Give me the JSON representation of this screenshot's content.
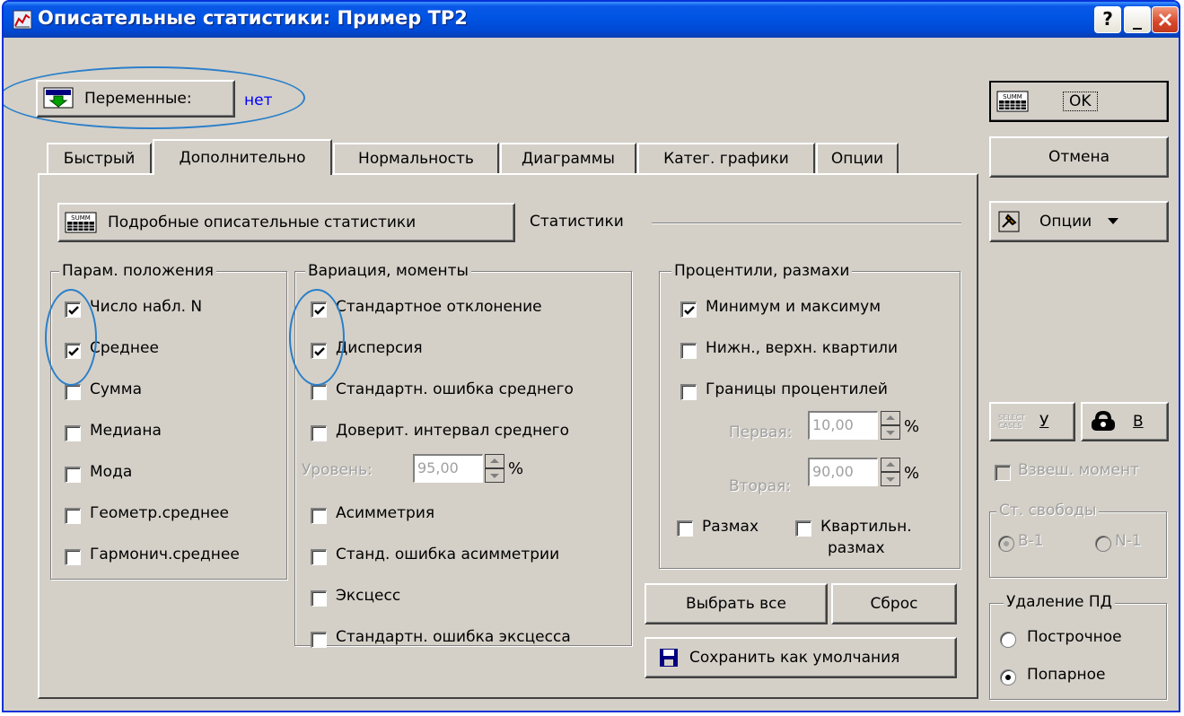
{
  "window": {
    "title": "Описательные статистики: Пример ТР2"
  },
  "variables": {
    "button_label": "Переменные:",
    "value": "нет"
  },
  "tabs": [
    {
      "label": "Быстрый"
    },
    {
      "label": "Дополнительно"
    },
    {
      "label": "Нормальность"
    },
    {
      "label": "Диаграммы"
    },
    {
      "label": "Катег. графики"
    },
    {
      "label": "Опции"
    }
  ],
  "detail_button": {
    "label": "Подробные описательные статистики"
  },
  "statistics_label": "Статистики",
  "location_group": {
    "title": "Парам. положения",
    "items": [
      {
        "label": "Число набл. N",
        "checked": true
      },
      {
        "label": "Среднее",
        "checked": true
      },
      {
        "label": "Сумма",
        "checked": false
      },
      {
        "label": "Медиана",
        "checked": false
      },
      {
        "label": "Мода",
        "checked": false
      },
      {
        "label": "Геометр.среднее",
        "checked": false
      },
      {
        "label": "Гармонич.среднее",
        "checked": false
      }
    ]
  },
  "variation_group": {
    "title": "Вариация, моменты",
    "items": [
      {
        "label": "Стандартное отклонение",
        "checked": true
      },
      {
        "label": "Дисперсия",
        "checked": true
      },
      {
        "label": "Стандартн. ошибка среднего",
        "checked": false
      },
      {
        "label": "Доверит. интервал среднего",
        "checked": false
      },
      {
        "label": "Асимметрия",
        "checked": false
      },
      {
        "label": "Станд. ошибка асимметрии",
        "checked": false
      },
      {
        "label": "Эксцесс",
        "checked": false
      },
      {
        "label": "Стандартн. ошибка эксцесса",
        "checked": false
      }
    ],
    "level_label": "Уровень:",
    "level_value": "95,00",
    "percent": "%"
  },
  "percentile_group": {
    "title": "Процентили, размахи",
    "items": [
      {
        "label": "Минимум и максимум",
        "checked": true
      },
      {
        "label": "Нижн., верхн. квартили",
        "checked": false
      },
      {
        "label": "Границы процентилей",
        "checked": false
      }
    ],
    "first_label": "Первая:",
    "first_value": "10,00",
    "second_label": "Вторая:",
    "second_value": "90,00",
    "percent": "%",
    "range_label": "Размах",
    "range_checked": false,
    "iqr_label_1": "Квартильн.",
    "iqr_label_2": "размах",
    "iqr_checked": false
  },
  "select_all_button": "Выбрать все",
  "reset_button": "Сброс",
  "save_defaults_button": "Сохранить как умолчания",
  "right_panel": {
    "ok_button": "OK",
    "cancel_button": "Отмена",
    "options_button": "Опции",
    "select_cases_icon_text": "SELECT CASES",
    "select_cases_key": "У",
    "weight_key": "В",
    "weighted_moments": "Взвеш. момент",
    "df_group": {
      "title": "Ст. свободы",
      "option1": "В-1",
      "option2": "N-1",
      "selected": "В-1"
    },
    "md_group": {
      "title": "Удаление ПД",
      "option1": "Построчное",
      "option2": "Попарное",
      "selected": "Попарное"
    }
  },
  "colors": {
    "title_bar": "#0054e3",
    "face": "#d4d0c8",
    "annotation": "#2a7fc9",
    "link_blue": "#0000ff"
  }
}
